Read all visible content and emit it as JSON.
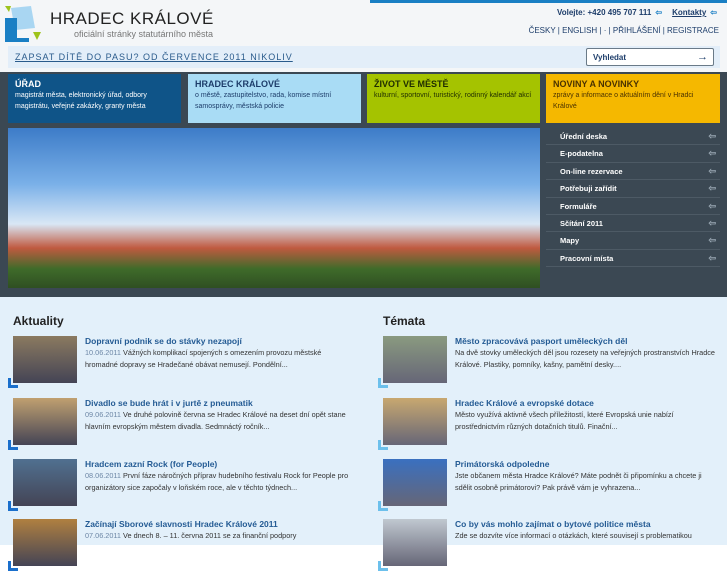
{
  "header": {
    "brand": "HRADEC KRÁLOVÉ",
    "subtitle": "oficiální stránky statutárního města",
    "phone": "Volejte: +420 495 707 111",
    "contacts": "Kontakty",
    "langs": "ČESKY | ENGLISH |  · | PŘIHLÁŠENÍ | REGISTRACE",
    "banner": "ZAPSAT DÍTĚ DO PASU? OD ČERVENCE 2011 NIKOLIV",
    "search_placeholder": "Vyhledat"
  },
  "tiles": [
    {
      "title": "ÚŘAD",
      "text": "magistrát města, elektronický úřad, odbory magistrátu, veřejné zakázky, granty města",
      "color": "#0f5488"
    },
    {
      "title": "HRADEC KRÁLOVÉ",
      "text": "o městě, zastupitelstvo, rada, komise místní samosprávy, městská policie",
      "color": "#a9dcf5"
    },
    {
      "title": "ŽIVOT VE MĚSTĚ",
      "text": "kulturní, sportovní, turistický, rodinný kalendář akcí",
      "color": "#a5c300"
    },
    {
      "title": "NOVINY A NOVINKY",
      "text": "zprávy a informace o aktuálním dění v Hradci Králové",
      "color": "#f5b800"
    }
  ],
  "side_menu": [
    "Úřední deska",
    "E-podatelna",
    "On-line rezervace",
    "Potřebuji zařídit",
    "Formuláře",
    "Sčítání 2011",
    "Mapy",
    "Pracovní místa"
  ],
  "news": {
    "heading": "Aktuality",
    "items": [
      {
        "title": "Dopravní podnik se do stávky nezapojí",
        "date": "10.06.2011",
        "text": "Vážných komplikací spojených s omezením provozu městské hromadné dopravy se Hradečané obávat nemusejí.  Pondělní..."
      },
      {
        "title": "Divadlo se bude hrát i v jurtě z pneumatik",
        "date": "09.06.2011",
        "text": "Ve druhé polovině června se Hradec Králové na deset dní opět stane hlavním evropským městem divadla. Sedmnáctý ročník..."
      },
      {
        "title": "Hradcem zazní Rock (for People)",
        "date": "08.06.2011",
        "text": "První fáze náročných příprav hudebního festivalu Rock for People pro organizátory sice započaly v loňském roce, ale v těchto týdnech..."
      },
      {
        "title": "Začínají Sborové slavnosti Hradec Králové 2011",
        "date": "07.06.2011",
        "text": "Ve dnech 8. – 11. června 2011 se za finanční podpory"
      }
    ]
  },
  "topics": {
    "heading": "Témata",
    "items": [
      {
        "title": "Město zpracovává pasport uměleckých děl",
        "text": "Na dvě stovky uměleckých děl jsou rozesety na veřejných prostranstvích Hradce Králové. Plastiky, pomníky, kašny, pamětní desky...."
      },
      {
        "title": "Hradec Králové a evropské dotace",
        "text": "Město využívá aktivně všech příležitostí, které Evropská unie nabízí prostřednictvím různých dotačních titulů. Finační..."
      },
      {
        "title": "Primátorská odpoledne",
        "text": "Jste občanem města Hradce Králové? Máte podnět či připomínku a chcete ji sdělit osobně primátorovi? Pak právě vám je vyhrazena..."
      },
      {
        "title": "Co by vás mohlo zajímat o bytové politice města",
        "text": "Zde se dozvíte více informací o otázkách, které souvisejí s problematikou"
      }
    ]
  }
}
